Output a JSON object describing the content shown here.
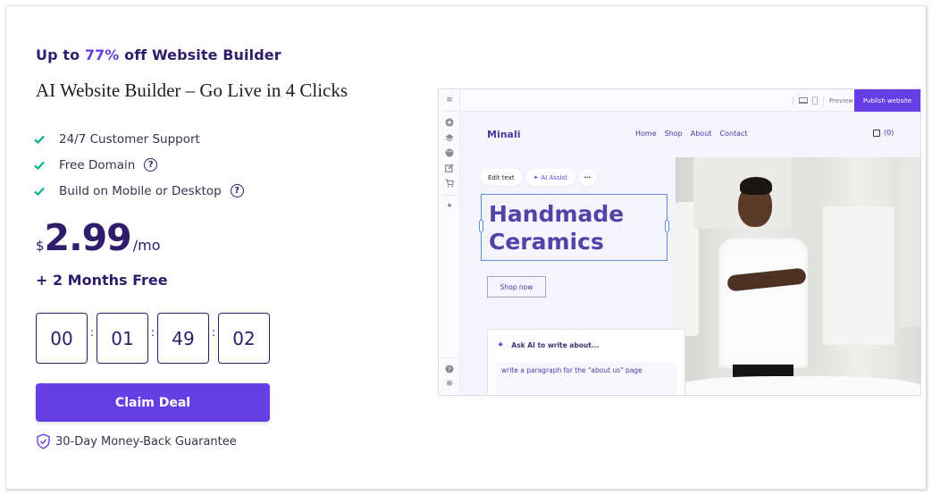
{
  "promo": {
    "prefix": "Up to ",
    "discount": "77%",
    "suffix": " off Website Builder"
  },
  "title": "AI Website Builder – Go Live in 4 Clicks",
  "features": [
    {
      "label": "24/7 Customer Support",
      "icon": "check-icon",
      "has_help": false
    },
    {
      "label": "Free Domain",
      "icon": "check-icon",
      "has_help": true
    },
    {
      "label": "Build on Mobile or Desktop",
      "icon": "check-icon",
      "has_help": true
    }
  ],
  "help_glyph": "?",
  "price": {
    "currency": "$",
    "amount": "2.99",
    "period": "/mo"
  },
  "bonus": "+ 2 Months Free",
  "countdown": {
    "days": "00",
    "hours": "01",
    "minutes": "49",
    "seconds": "02",
    "separator": ":"
  },
  "cta": {
    "label": "Claim Deal"
  },
  "guarantee": {
    "label": "30-Day Money-Back Guarantee",
    "icon": "shield-check-icon"
  },
  "colors": {
    "brand": "#673de6",
    "text_dark": "#2f1c6a",
    "check": "#00b090"
  },
  "preview": {
    "toolbar": {
      "preview_label": "Preview",
      "publish_label": "Publish website"
    },
    "sidebar_icons": [
      "menu-icon",
      "add-icon",
      "layers-icon",
      "palette-icon",
      "edit-icon",
      "cart-icon",
      "ai-sparkle-icon",
      "help-icon",
      "settings-icon"
    ],
    "site": {
      "brand": "Minali",
      "nav": [
        "Home",
        "Shop",
        "About",
        "Contact"
      ],
      "cart_count": "(0)",
      "chips": {
        "edit": "Edit text",
        "ai": "AI Assist",
        "more": "···"
      },
      "headline_line1": "Handmade",
      "headline_line2": "Ceramics",
      "shop_button": "Shop now"
    },
    "ai_panel": {
      "title": "Ask AI to write about...",
      "prompt": "write a paragraph for the \"about us\" page"
    }
  }
}
